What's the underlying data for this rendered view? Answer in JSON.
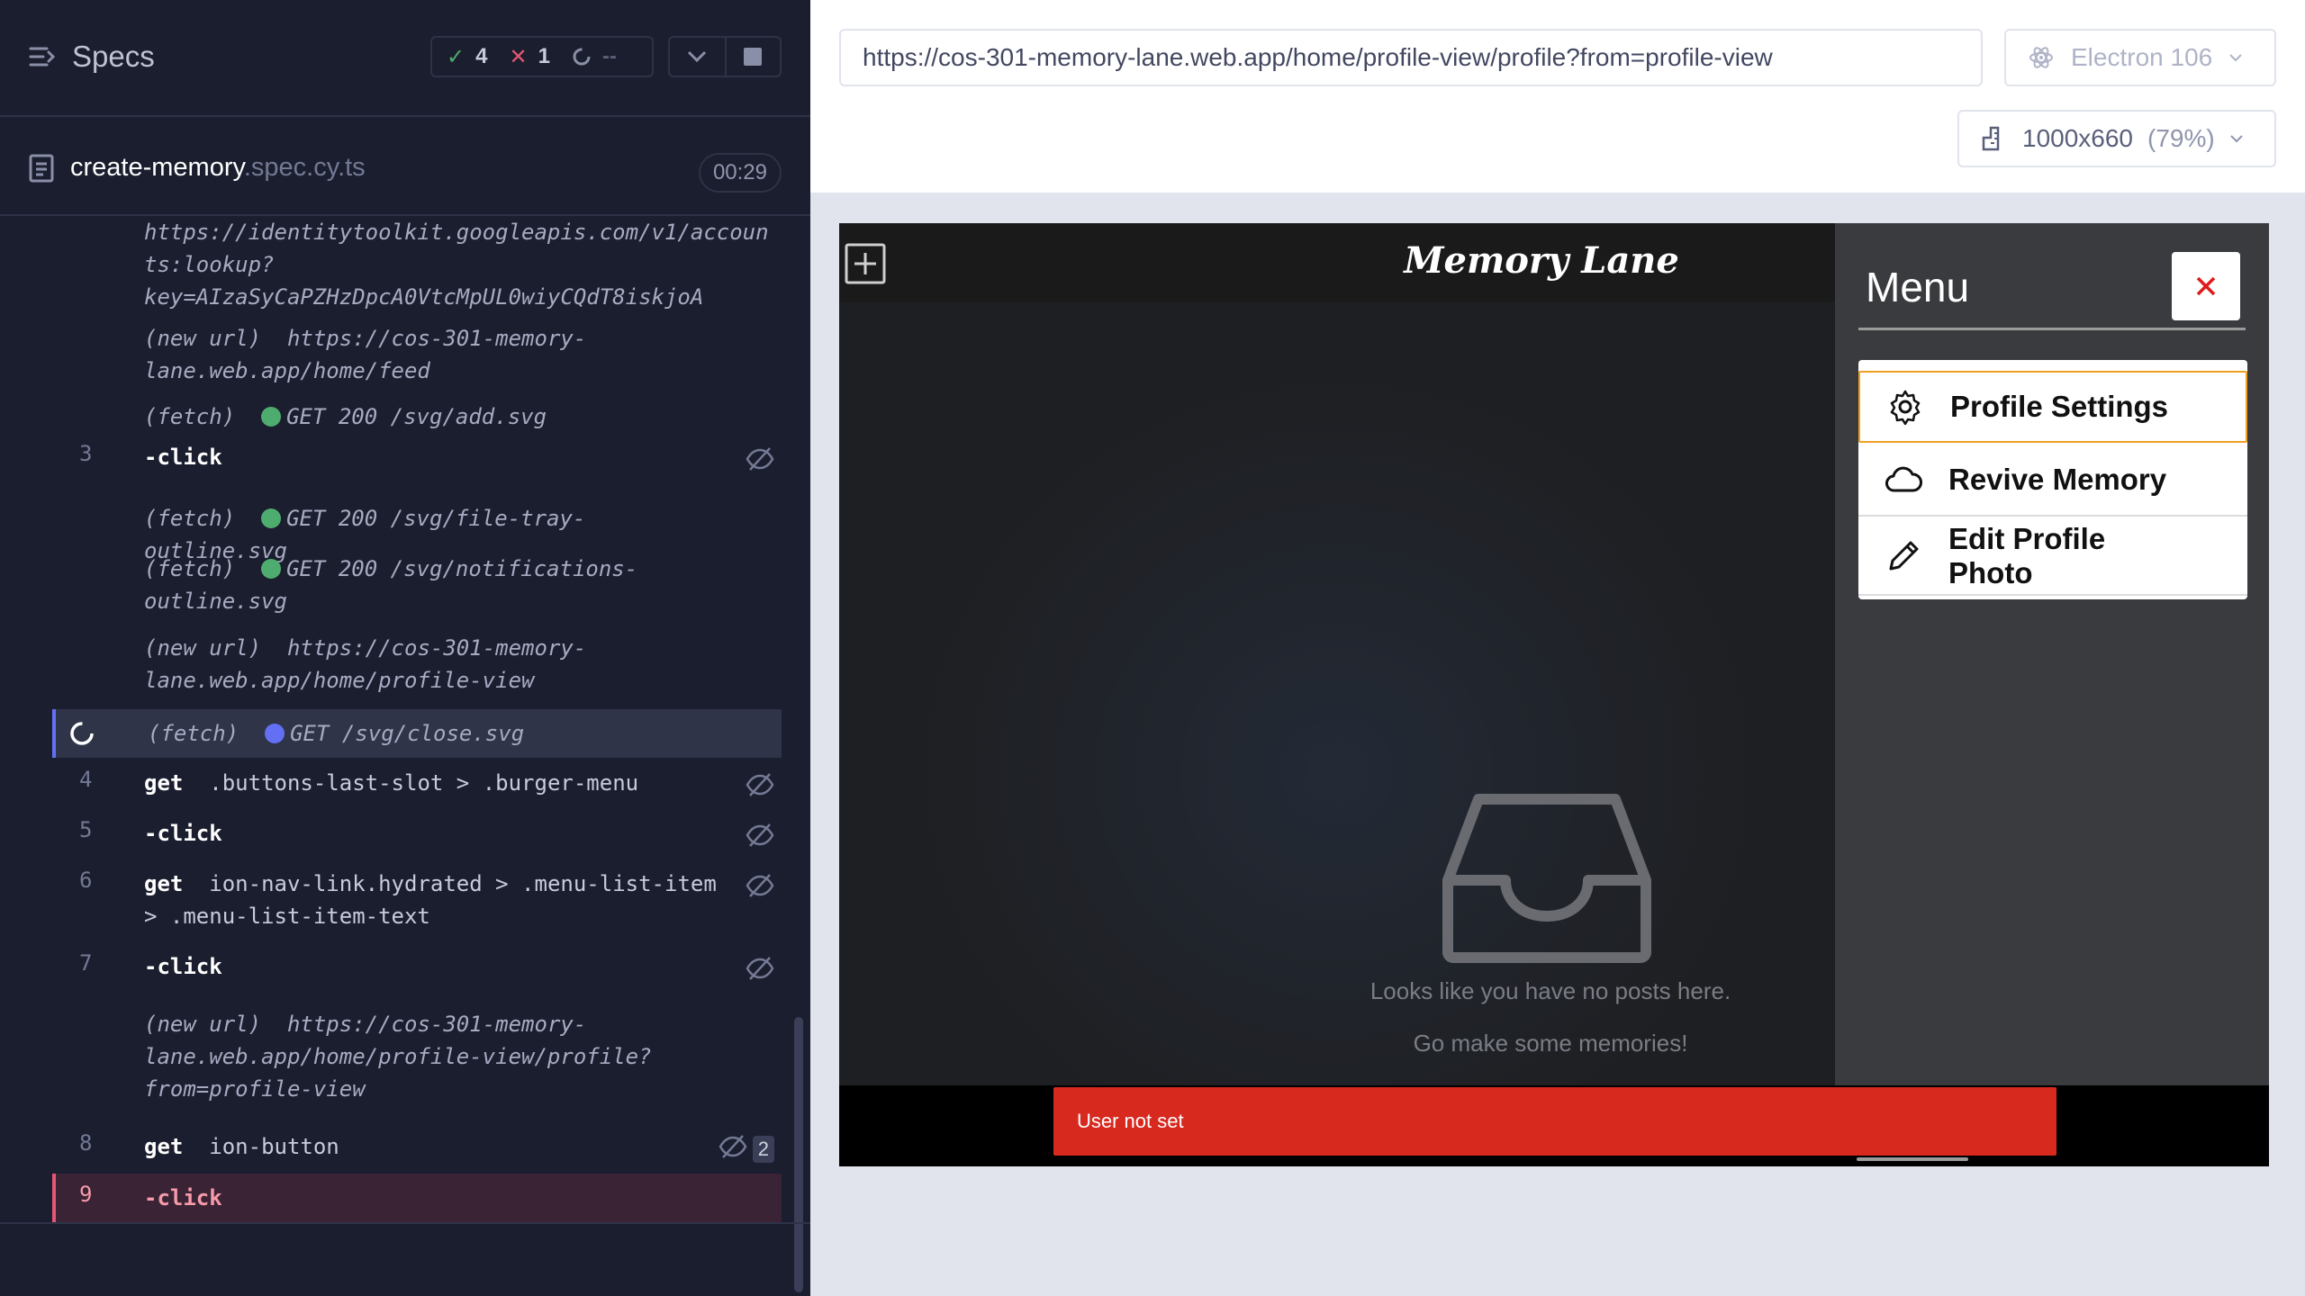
{
  "reporter": {
    "specs_label": "Specs",
    "stats": {
      "passed": "4",
      "failed": "1",
      "pending": "--"
    },
    "spec_file": {
      "name": "create-memory",
      "ext": ".spec.cy.ts",
      "duration": "00:29"
    },
    "commands": [
      {
        "num": "",
        "type": "fetch",
        "line1": "https://identitytoolkit.googleapis.com/v1/accoun",
        "line2": "ts:lookup?",
        "line3": "key=AIzaSyCaPZHzDpcA0VtcMpUL0wiyCQdT8iskjoA"
      },
      {
        "num": "",
        "prefix": "(new url)",
        "line1": "https://cos-301-memory-",
        "line2": "lane.web.app/home/feed"
      },
      {
        "num": "",
        "prefix": "(fetch)",
        "text": "GET 200 /svg/add.svg",
        "dot": "#4ead6e"
      },
      {
        "num": "3",
        "cmd": "-click"
      },
      {
        "num": "",
        "prefix": "(fetch)",
        "text": "GET 200 /svg/file-tray-outline.svg",
        "dot": "#4ead6e"
      },
      {
        "num": "",
        "prefix": "(fetch)",
        "text": "GET 200 /svg/notifications-",
        "line2": "outline.svg",
        "dot": "#4ead6e"
      },
      {
        "num": "",
        "prefix": "(new url)",
        "line1": "https://cos-301-memory-",
        "line2": "lane.web.app/home/profile-view"
      },
      {
        "num": "",
        "prefix": "(fetch)",
        "text": "GET /svg/close.svg",
        "dot": "#6470f3"
      },
      {
        "num": "4",
        "cmd": "get",
        "selector": ".buttons-last-slot > .burger-menu"
      },
      {
        "num": "5",
        "cmd": "-click"
      },
      {
        "num": "6",
        "cmd": "get",
        "selector": "ion-nav-link.hydrated > .menu-list-item",
        "line2": "> .menu-list-item-text"
      },
      {
        "num": "7",
        "cmd": "-click"
      },
      {
        "num": "",
        "prefix": "(new url)",
        "line1": "https://cos-301-memory-",
        "line2": "lane.web.app/home/profile-view/profile?",
        "line3": "from=profile-view"
      },
      {
        "num": "8",
        "cmd": "get",
        "selector": "ion-button",
        "badge": "2"
      },
      {
        "num": "9",
        "cmd": "-click"
      }
    ]
  },
  "aut": {
    "url": "https://cos-301-memory-lane.web.app/home/profile-view/profile?from=profile-view",
    "browser": "Electron 106",
    "viewport": "1000x660",
    "zoom": "(79%)"
  },
  "app": {
    "title": "Memory Lane",
    "empty_line1": "Looks like you have no posts here.",
    "empty_line2": "Go make some memories!",
    "toast": "User not set",
    "menu": {
      "title": "Menu",
      "items": [
        {
          "label": "Profile Settings",
          "icon": "gear-icon"
        },
        {
          "label": "Revive Memory",
          "icon": "cloud-icon"
        },
        {
          "label": "Edit Profile Photo",
          "icon": "pencil-icon"
        }
      ]
    }
  },
  "colors": {
    "pass": "#4ead6e",
    "fail": "#e45770",
    "accent": "#6470f3",
    "toast": "#d8291f"
  }
}
